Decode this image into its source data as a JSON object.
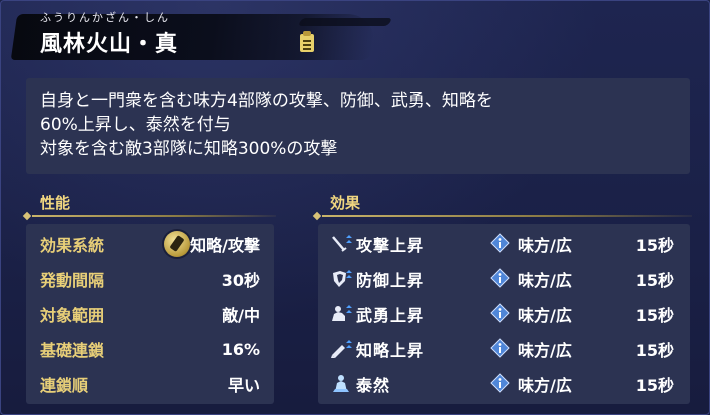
{
  "header": {
    "ruby": "ふうりんかざん・しん",
    "title": "風林火山・真",
    "doc_icon": "document-icon"
  },
  "description": {
    "lines": [
      "自身と一門衆を含む味方4部隊の攻撃、防御、武勇、知略を",
      "60%上昇し、泰然を付与",
      "対象を含む敵3部隊に知略300%の攻撃"
    ]
  },
  "performance": {
    "heading": "性能",
    "rows": [
      {
        "label": "効果系統",
        "value": "知略/攻撃",
        "icon": "intellect-seal-icon"
      },
      {
        "label": "発動間隔",
        "value": "30秒"
      },
      {
        "label": "対象範囲",
        "value": "敵/中"
      },
      {
        "label": "基礎連鎖",
        "value": "16%"
      },
      {
        "label": "連鎖順",
        "value": "早い"
      }
    ]
  },
  "effects": {
    "heading": "効果",
    "rows": [
      {
        "name": "攻撃上昇",
        "icon": "attack-up-icon",
        "target": "味方/広",
        "duration": "15秒"
      },
      {
        "name": "防御上昇",
        "icon": "defense-up-icon",
        "target": "味方/広",
        "duration": "15秒"
      },
      {
        "name": "武勇上昇",
        "icon": "valor-up-icon",
        "target": "味方/広",
        "duration": "15秒"
      },
      {
        "name": "知略上昇",
        "icon": "intellect-up-icon",
        "target": "味方/広",
        "duration": "15秒"
      },
      {
        "name": "泰然",
        "icon": "composure-icon",
        "target": "味方/広",
        "duration": "15秒"
      }
    ]
  },
  "colors": {
    "background": "#1b2246",
    "panel": "#2c3352",
    "label_gold": "#e8cf78",
    "info_blue": "#4f86d8"
  }
}
